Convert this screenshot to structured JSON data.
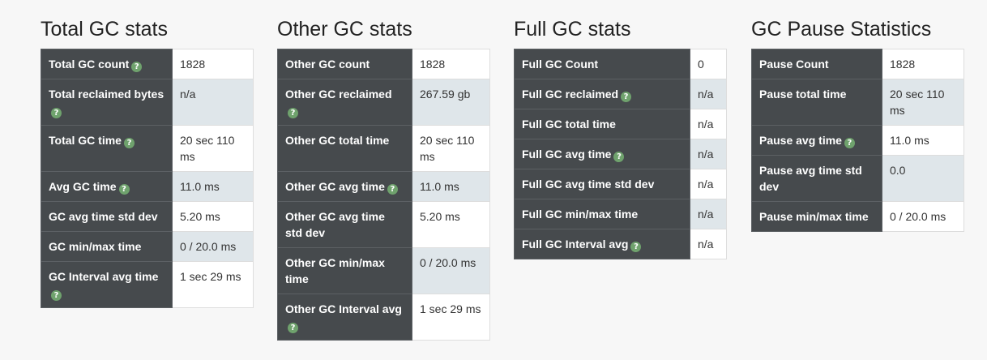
{
  "help_glyph": "?",
  "panels": [
    {
      "title": "Total GC stats",
      "rows": [
        {
          "label": "Total GC count",
          "help": true,
          "value": "1828"
        },
        {
          "label": "Total reclaimed bytes",
          "help": true,
          "value": "n/a"
        },
        {
          "label": "Total GC time",
          "help": true,
          "value": "20 sec 110 ms"
        },
        {
          "label": "Avg GC time",
          "help": true,
          "value": "11.0 ms"
        },
        {
          "label": "GC avg time std dev",
          "help": false,
          "value": "5.20 ms"
        },
        {
          "label": "GC min/max time",
          "help": false,
          "value": "0 / 20.0 ms"
        },
        {
          "label": "GC Interval avg time",
          "help": true,
          "value": "1 sec 29 ms"
        }
      ]
    },
    {
      "title": "Other GC stats",
      "rows": [
        {
          "label": "Other GC count",
          "help": false,
          "value": "1828"
        },
        {
          "label": "Other GC reclaimed",
          "help": true,
          "value": "267.59 gb"
        },
        {
          "label": "Other GC total time",
          "help": false,
          "value": "20 sec 110 ms"
        },
        {
          "label": "Other GC avg time",
          "help": true,
          "value": "11.0 ms"
        },
        {
          "label": "Other GC avg time std dev",
          "help": false,
          "value": "5.20 ms"
        },
        {
          "label": "Other GC min/max time",
          "help": false,
          "value": "0 / 20.0 ms"
        },
        {
          "label": "Other GC Interval avg",
          "help": true,
          "value": "1 sec 29 ms"
        }
      ]
    },
    {
      "title": "Full GC stats",
      "rows": [
        {
          "label": "Full GC Count",
          "help": false,
          "value": "0"
        },
        {
          "label": "Full GC reclaimed",
          "help": true,
          "value": "n/a"
        },
        {
          "label": "Full GC total time",
          "help": false,
          "value": "n/a"
        },
        {
          "label": "Full GC avg time",
          "help": true,
          "value": "n/a"
        },
        {
          "label": "Full GC avg time std dev",
          "help": false,
          "value": "n/a"
        },
        {
          "label": "Full GC min/max time",
          "help": false,
          "value": "n/a"
        },
        {
          "label": "Full GC Interval avg",
          "help": true,
          "value": "n/a"
        }
      ]
    },
    {
      "title": "GC Pause Statistics",
      "rows": [
        {
          "label": "Pause Count",
          "help": false,
          "value": "1828"
        },
        {
          "label": "Pause total time",
          "help": false,
          "value": "20 sec 110 ms"
        },
        {
          "label": "Pause avg time",
          "help": true,
          "value": "11.0 ms"
        },
        {
          "label": "Pause avg time std dev",
          "help": false,
          "value": "0.0"
        },
        {
          "label": "Pause min/max time",
          "help": false,
          "value": "0 / 20.0 ms"
        }
      ]
    }
  ]
}
